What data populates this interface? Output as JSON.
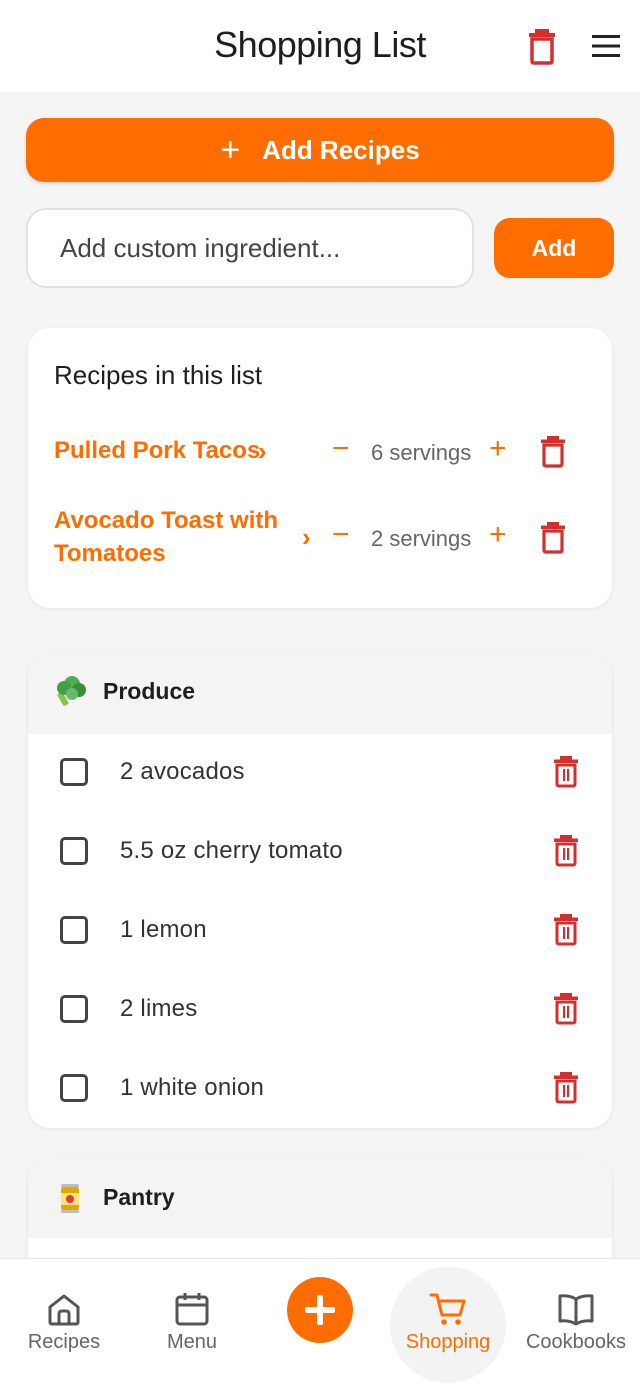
{
  "header": {
    "title": "Shopping List"
  },
  "actions": {
    "add_recipes_label": "Add Recipes",
    "custom_placeholder": "Add custom ingredient...",
    "add_label": "Add"
  },
  "recipes_card": {
    "title": "Recipes in this list",
    "recipes": [
      {
        "name": "Pulled Pork Tacos",
        "servings": "6 servings"
      },
      {
        "name": "Avocado Toast with Tomatoes",
        "servings": "2 servings"
      }
    ]
  },
  "categories": [
    {
      "name": "Produce",
      "emoji": "broccoli-icon",
      "items": [
        "2 avocados",
        "5.5 oz cherry tomato",
        "1 lemon",
        "2 limes",
        "1 white onion"
      ]
    },
    {
      "name": "Pantry",
      "emoji": "canned-food-icon",
      "items": []
    }
  ],
  "nav": {
    "items": [
      {
        "label": "Recipes",
        "icon": "home-icon"
      },
      {
        "label": "Menu",
        "icon": "calendar-icon"
      },
      {
        "label": "",
        "icon": "plus-icon"
      },
      {
        "label": "Shopping",
        "icon": "cart-icon",
        "active": true
      },
      {
        "label": "Cookbooks",
        "icon": "book-icon"
      }
    ]
  },
  "colors": {
    "accent": "#ff6d00",
    "danger": "#d32f2f",
    "background": "#f5f5f5"
  }
}
